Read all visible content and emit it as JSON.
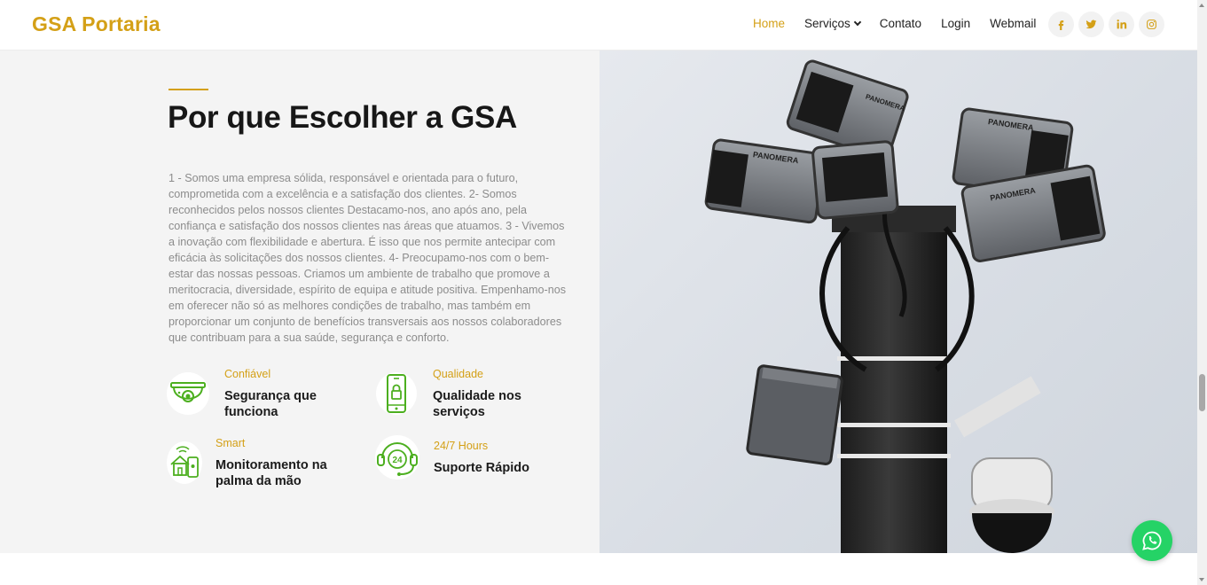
{
  "header": {
    "logo": "GSA Portaria",
    "nav": [
      {
        "label": "Home",
        "active": true
      },
      {
        "label": "Serviços",
        "dropdown": true
      },
      {
        "label": "Contato"
      },
      {
        "label": "Login"
      },
      {
        "label": "Webmail"
      }
    ],
    "socials": [
      "facebook-icon",
      "twitter-icon",
      "linkedin-icon",
      "instagram-icon"
    ]
  },
  "main": {
    "title": "Por que Escolher a GSA",
    "description": "1 - Somos uma empresa sólida, responsável e orientada para o futuro, comprometida com a excelência e a satisfação dos clientes. 2- Somos reconhecidos pelos nossos clientes Destacamo-nos, ano após ano, pela confiança e satisfação dos nossos clientes nas áreas que atuamos. 3 - Vivemos a inovação com flexibilidade e abertura. É isso que nos permite antecipar com eficácia às solicitações dos nossos clientes. 4- Preocupamo-nos com o bem-estar das nossas pessoas. Criamos um ambiente de trabalho que promove a meritocracia, diversidade, espírito de equipa e atitude positiva. Empenhamo-nos em oferecer não só as melhores condições de trabalho, mas também em proporcionar um conjunto de benefícios transversais aos nossos colaboradores que contribuam para a sua saúde, segurança e conforto.",
    "features": [
      {
        "small": "Confiável",
        "big": "Segurança que funciona",
        "icon": "security-camera-icon"
      },
      {
        "small": "Qualidade",
        "big": "Qualidade nos serviços",
        "icon": "phone-lock-icon"
      },
      {
        "small": "Smart",
        "big": "Monitoramento na palma da mão",
        "icon": "smart-home-icon"
      },
      {
        "small": "24/7 Hours",
        "big": "Suporte Rápido",
        "icon": "headset-24-icon"
      }
    ]
  },
  "image": {
    "camera_brand": "PANOMERA"
  },
  "colors": {
    "accent": "#d4a017",
    "icon_green": "#4caf1f",
    "whatsapp": "#25d366"
  }
}
